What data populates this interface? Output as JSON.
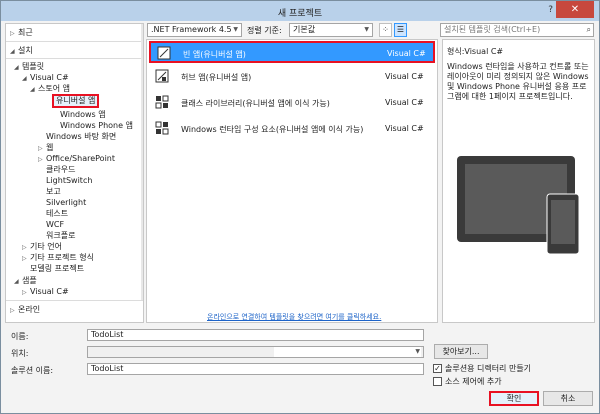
{
  "window": {
    "title": "새 프로젝트",
    "help_button": "?",
    "close_button": "✕"
  },
  "left_tree": {
    "recent": "최근",
    "installed": "설치",
    "templates": "템플릿",
    "visual_csharp": "Visual C#",
    "store_apps": "스토어 앱",
    "universal_apps": "유니버설 앱",
    "windows_apps": "Windows 앱",
    "windows_phone_apps": "Windows Phone 앱",
    "windows_desktop": "Windows 바탕 화면",
    "web": "웹",
    "office_sharepoint": "Office/SharePoint",
    "cloud": "클라우드",
    "lightswitch": "LightSwitch",
    "reporting": "보고",
    "silverlight": "Silverlight",
    "test": "테스트",
    "wcf": "WCF",
    "workflow": "워크플로",
    "other_languages": "기타 언어",
    "other_project_types": "기타 프로젝트 형식",
    "modeling_projects": "모델링 프로젝트",
    "samples": "샘플",
    "samples_visual_csharp": "Visual C#",
    "online": "온라인"
  },
  "toolbar": {
    "framework": ".NET Framework 4.5",
    "sort_label": "정렬 기준:",
    "sort_value": "기본값"
  },
  "search": {
    "placeholder": "설치된 템플릿 검색(Ctrl+E)"
  },
  "templates": [
    {
      "name": "빈 앱(유니버설 앱)",
      "lang": "Visual C#"
    },
    {
      "name": "허브 앱(유니버설 앱)",
      "lang": "Visual C#"
    },
    {
      "name": "클래스 라이브러리(유니버설 앱에 이식 가능)",
      "lang": "Visual C#"
    },
    {
      "name": "Windows 런타임 구성 요소(유니버설 앱에 이식 가능)",
      "lang": "Visual C#"
    }
  ],
  "online_link": "온라인으로 연결하여 템플릿을 찾으려면 여기를 클릭하세요.",
  "details": {
    "type": "형식:Visual C#",
    "description": "Windows 런타임을 사용하고 컨트롤 또는 레이아웃이 미리 정의되지 않은 Windows 및 Windows Phone 유니버설 응용 프로그램에 대한 1페이지 프로젝트입니다."
  },
  "form": {
    "name_label": "이름:",
    "name_value": "TodoList",
    "location_label": "위치:",
    "solution_label": "솔루션 이름:",
    "solution_value": "TodoList",
    "browse": "찾아보기...",
    "create_dir": "솔루션용 디렉터리 만들기",
    "create_dir_checked": true,
    "add_source_control": "소스 제어에 추가",
    "add_source_control_checked": false,
    "ok": "확인",
    "cancel": "취소"
  }
}
